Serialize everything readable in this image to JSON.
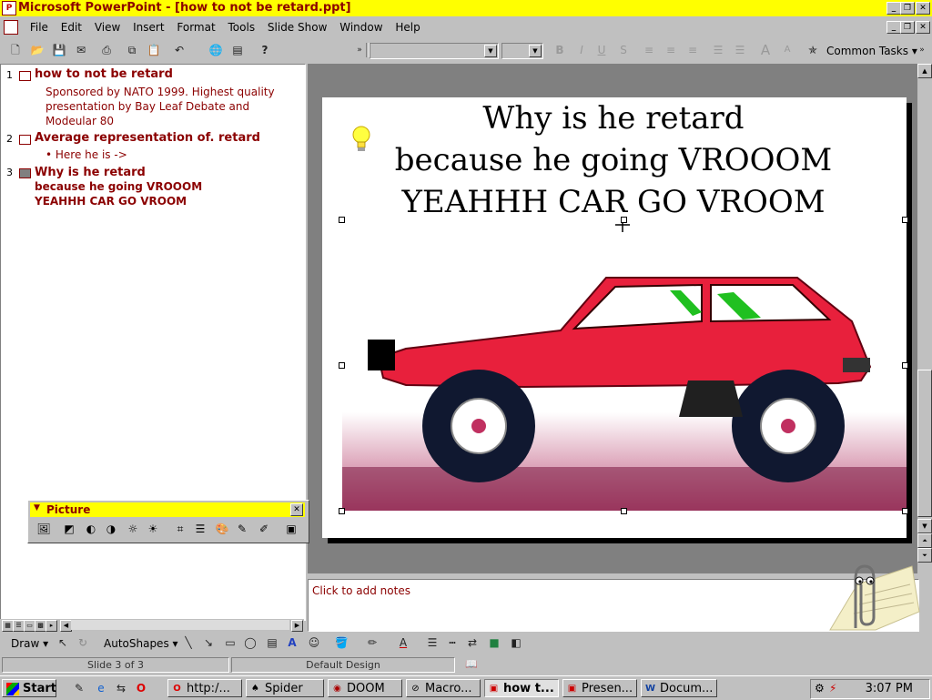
{
  "window": {
    "title": "Microsoft PowerPoint - [how to not be retard.ppt]",
    "controls": [
      "_",
      "❐",
      "✕"
    ]
  },
  "menu": [
    {
      "u": "F",
      "rest": "ile"
    },
    {
      "u": "E",
      "rest": "dit"
    },
    {
      "u": "V",
      "rest": "iew"
    },
    {
      "u": "I",
      "rest": "nsert"
    },
    {
      "u": "F",
      "rest": "ormat",
      "prefix": ""
    },
    {
      "u": "T",
      "rest": "ools"
    },
    {
      "u": "S",
      "rest": "lide Show"
    },
    {
      "u": "W",
      "rest": "indow"
    },
    {
      "u": "H",
      "rest": "elp"
    }
  ],
  "menu_labels": [
    "File",
    "Edit",
    "View",
    "Insert",
    "Format",
    "Tools",
    "Slide Show",
    "Window",
    "Help"
  ],
  "toolbar": {
    "common_tasks": "Common Tasks"
  },
  "outline": {
    "slides": [
      {
        "num": "1",
        "title": "how to not be retard",
        "body": "Sponsored by NATO 1999. Highest quality presentation by Bay Leaf Debate and Modeular 80"
      },
      {
        "num": "2",
        "title": "Average representation of. retard",
        "bullet": "• Here he is ->"
      },
      {
        "num": "3",
        "title_lines": [
          "Why is he retard",
          "because he going VROOOM",
          "YEAHHH CAR GO VROOM"
        ]
      }
    ]
  },
  "slide": {
    "title_lines": [
      "Why is he retard",
      "because he going VROOOM",
      "YEAHHH CAR GO VROOM"
    ]
  },
  "picture_toolbar": {
    "title": "Picture"
  },
  "notes": {
    "placeholder": "Click to add notes"
  },
  "draw_toolbar": {
    "draw": "Draw",
    "autoshapes": "AutoShapes"
  },
  "status": {
    "slide": "Slide 3 of 3",
    "design": "Default Design"
  },
  "taskbar": {
    "start": "Start",
    "tasks": [
      "http:/...",
      "Spider",
      "DOOM",
      "Macro...",
      "how t...",
      "Presen...",
      "Docum..."
    ],
    "clock": "3:07 PM"
  },
  "colors": {
    "titlebar": "#ffff00",
    "accent_text": "#8b0000",
    "car_body": "#e8203c"
  }
}
